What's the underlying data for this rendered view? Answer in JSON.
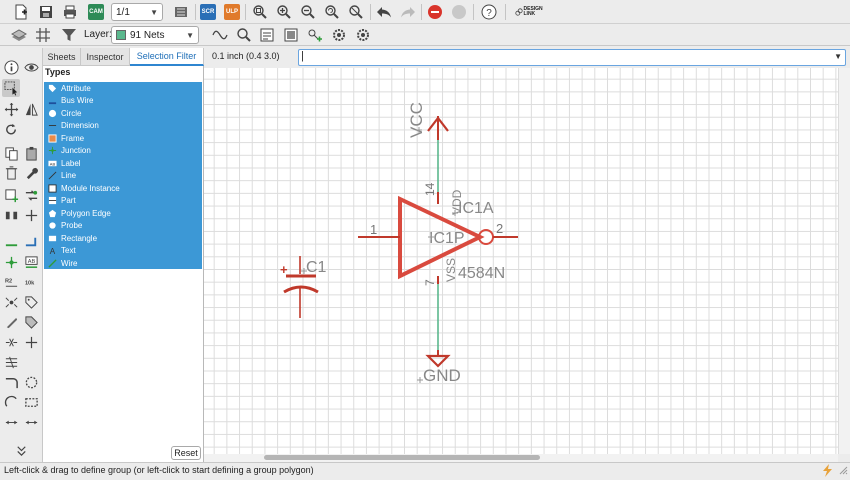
{
  "toolbar": {
    "sheet_select": "1/1",
    "scr_label": "SCR",
    "ulp_label": "ULP",
    "design_link_label": "DESIGN LINK",
    "layer_label": "Layer:",
    "layer_value": "91 Nets",
    "layer_color": "#5bb88e"
  },
  "panel": {
    "tabs": [
      "Sheets",
      "Inspector",
      "Selection Filter"
    ],
    "types_title": "Types",
    "types": [
      "Attribute",
      "Bus Wire",
      "Circle",
      "Dimension",
      "Frame",
      "Junction",
      "Label",
      "Line",
      "Module Instance",
      "Part",
      "Polygon Edge",
      "Probe",
      "Rectangle",
      "Text",
      "Wire"
    ],
    "reset_label": "Reset",
    "selection_color": "#3c98d6"
  },
  "command": {
    "coordinate": "0.1 inch (0.4 3.0)",
    "input_value": "",
    "input_cursor": "|"
  },
  "schematic": {
    "vcc": "VCC",
    "gnd": "GND",
    "ic_name": "IC1A",
    "ic_p": "IC1P",
    "ic_value": "4584N",
    "pin_in": "1",
    "pin_out": "2",
    "pin_vdd_num": "14",
    "pin_vss_num": "7",
    "vdd": "VDD",
    "vss": "VSS",
    "cap": "C1",
    "plus": "+",
    "symbol_color": "#c0392b",
    "net_color": "#5bb88e"
  },
  "status": {
    "text": "Left-click & drag to define group (or left-click to start defining a group polygon)"
  }
}
